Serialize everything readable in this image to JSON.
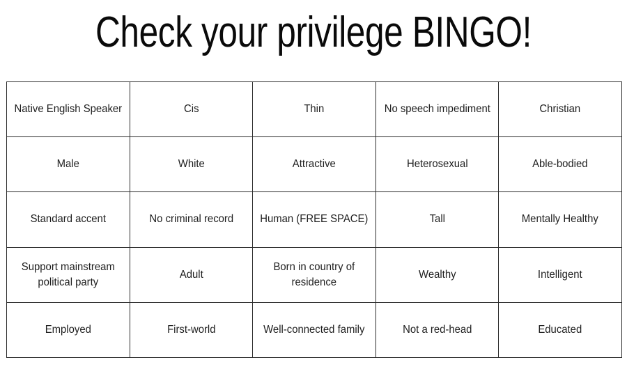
{
  "title": "Check your privilege BINGO!",
  "colors": {
    "background": "#ffffff",
    "title_text": "#0a0a0a",
    "cell_text": "#1e1e1e",
    "grid_line": "#2b2b2b"
  },
  "grid": {
    "rows": 5,
    "columns": 5,
    "free_space_cell": "Human\n(FREE SPACE)",
    "cells": [
      [
        "Native English Speaker",
        "Cis",
        "Thin",
        "No speech impediment",
        "Christian"
      ],
      [
        "Male",
        "White",
        "Attractive",
        "Heterosexual",
        "Able-bodied"
      ],
      [
        "Standard accent",
        "No criminal record",
        "Human (FREE SPACE)",
        "Tall",
        "Mentally Healthy"
      ],
      [
        "Support mainstream political party",
        "Adult",
        "Born in country of residence",
        "Wealthy",
        "Intelligent"
      ],
      [
        "Employed",
        "First-world",
        "Well-connected family",
        "Not a red-head",
        "Educated"
      ]
    ]
  }
}
